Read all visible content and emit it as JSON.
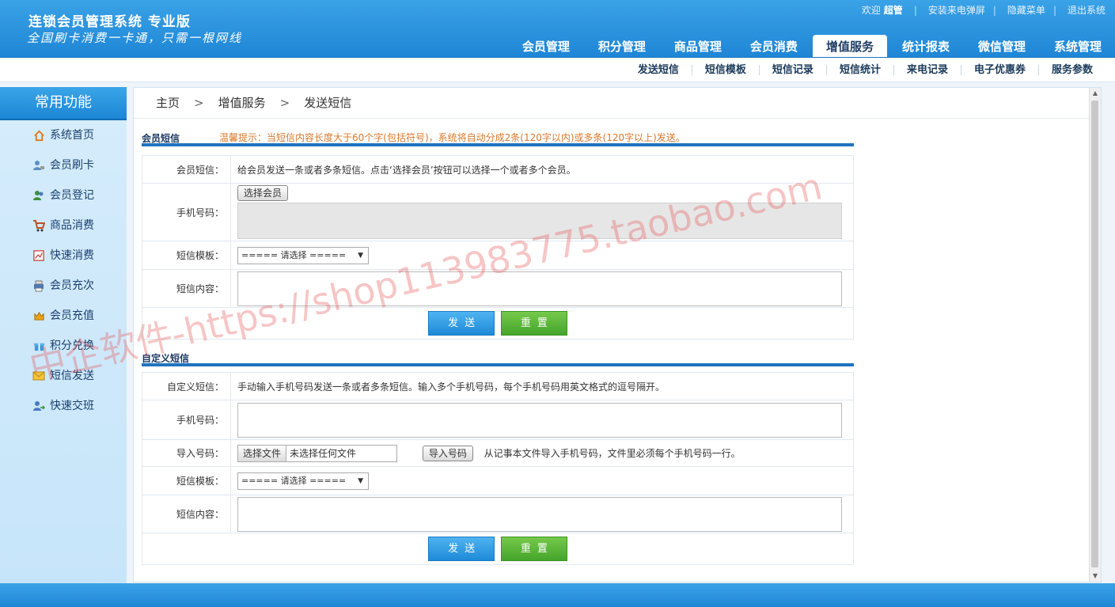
{
  "header": {
    "title": "连锁会员管理系统 专业版",
    "slogan": "全国刷卡消费一卡通，只需一根网线",
    "welcome": "欢迎",
    "user": "超管",
    "links": [
      "安装来电弹屏",
      "隐藏菜单",
      "退出系统"
    ],
    "nav": [
      "会员管理",
      "积分管理",
      "商品管理",
      "会员消费",
      "增值服务",
      "统计报表",
      "微信管理",
      "系统管理"
    ],
    "active_nav": "增值服务"
  },
  "subnav": [
    "发送短信",
    "短信模板",
    "短信记录",
    "短信统计",
    "来电记录",
    "电子优惠券",
    "服务参数"
  ],
  "sidebar": {
    "title": "常用功能",
    "items": [
      {
        "label": "系统首页",
        "icon": "home-icon"
      },
      {
        "label": "会员刷卡",
        "icon": "user-card-icon"
      },
      {
        "label": "会员登记",
        "icon": "users-icon"
      },
      {
        "label": "商品消费",
        "icon": "cart-icon"
      },
      {
        "label": "快速消费",
        "icon": "chart-icon"
      },
      {
        "label": "会员充次",
        "icon": "printer-icon"
      },
      {
        "label": "会员充值",
        "icon": "crown-icon"
      },
      {
        "label": "积分兑换",
        "icon": "gift-icon"
      },
      {
        "label": "短信发送",
        "icon": "mail-icon"
      },
      {
        "label": "快速交班",
        "icon": "user-switch-icon"
      }
    ]
  },
  "breadcrumb": [
    "主页",
    "增值服务",
    "发送短信"
  ],
  "member_sms": {
    "title": "会员短信",
    "tip": "温馨提示：当短信内容长度大于60个字(包括符号)，系统将自动分成2条(120字以内)或多条(120字以上)发送。",
    "rows": {
      "intro_label": "会员短信：",
      "intro_text": "给会员发送一条或者多条短信。点击‘选择会员’按钮可以选择一个或者多个会员。",
      "phone_label": "手机号码：",
      "select_member": "选择会员",
      "template_label": "短信模板：",
      "template_value": "===== 请选择 =====",
      "content_label": "短信内容："
    },
    "send": "发送",
    "reset": "重置"
  },
  "custom_sms": {
    "title": "自定义短信",
    "rows": {
      "intro_label": "自定义短信：",
      "intro_text": "手动输入手机号码发送一条或者多条短信。输入多个手机号码，每个手机号码用英文格式的逗号隔开。",
      "phone_label": "手机号码：",
      "import_label": "导入号码：",
      "choose_file": "选择文件",
      "no_file": "未选择任何文件",
      "import_button": "导入号码",
      "import_hint": "从记事本文件导入手机号码，文件里必须每个手机号码一行。",
      "template_label": "短信模板：",
      "template_value": "===== 请选择 =====",
      "content_label": "短信内容："
    },
    "send": "发送",
    "reset": "重置"
  },
  "watermark": "中企软件-https://shop113983775.taobao.com",
  "colors": {
    "header_blue": "#1f86d6",
    "section_line": "#1f74bf",
    "tip_orange": "#d8782a",
    "send_blue": "#1e8ad8",
    "reset_green": "#44a52a"
  }
}
